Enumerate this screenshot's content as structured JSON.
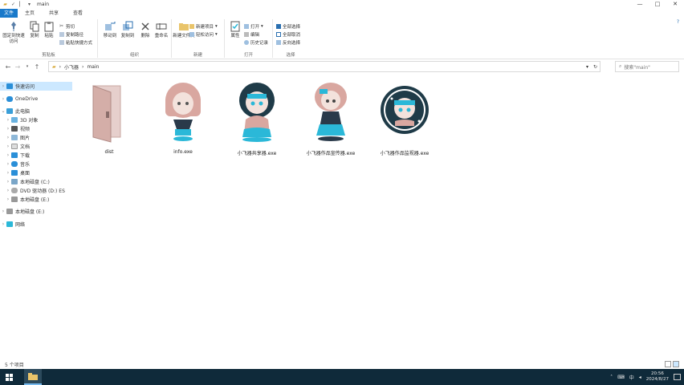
{
  "window": {
    "title": "main",
    "controls": [
      "—",
      "□",
      "✕"
    ]
  },
  "ribbon": {
    "tabs": [
      "文件",
      "主页",
      "共享",
      "查看"
    ],
    "groups": {
      "clipboard": {
        "label": "剪贴板",
        "pin": "固定到快速访问",
        "copy": "复制",
        "paste": "粘贴",
        "cut": "剪切",
        "copy_path": "复制路径",
        "paste_shortcut": "粘贴快捷方式"
      },
      "organize": {
        "label": "组织",
        "move_to": "移动到",
        "copy_to": "复制到",
        "delete": "删除",
        "rename": "重命名"
      },
      "new": {
        "label": "新建",
        "new_folder": "新建文件夹",
        "new_item": "新建项目",
        "easy_access": "轻松访问"
      },
      "open": {
        "label": "打开",
        "properties": "属性",
        "open": "打开",
        "edit": "编辑",
        "history": "历史记录"
      },
      "select": {
        "label": "选择",
        "select_all": "全部选择",
        "select_none": "全部取消",
        "invert": "反向选择"
      }
    }
  },
  "addressbar": {
    "path": [
      "小飞器",
      "main"
    ],
    "search_placeholder": "搜索\"main\""
  },
  "navpane": {
    "quick_access": "快速访问",
    "onedrive": "OneDrive",
    "this_pc": "此电脑",
    "pc_items": [
      "3D 对象",
      "视频",
      "图片",
      "文档",
      "下载",
      "音乐",
      "桌面",
      "本地磁盘 (C:)",
      "DVD 驱动器 (D:) ES",
      "本地磁盘 (E:)"
    ],
    "drive_e": "本地磁盘 (E:)",
    "network": "网络"
  },
  "files": [
    {
      "name": "dist",
      "type": "folder"
    },
    {
      "name": "info.exe",
      "type": "exe"
    },
    {
      "name": "小飞器共享器.exe",
      "type": "exe"
    },
    {
      "name": "小飞器作品宣传器.exe",
      "type": "exe"
    },
    {
      "name": "小飞器作品监视器.exe",
      "type": "exe"
    }
  ],
  "status": {
    "count": "5 个项目"
  },
  "taskbar": {
    "time": "20:56",
    "date": "2024/8/27",
    "ime": "中"
  },
  "colors": {
    "accent": "#1979ca",
    "cyan": "#2bb8d8",
    "skin": "#d9a7a0",
    "taskbar": "#0f2a3a"
  }
}
